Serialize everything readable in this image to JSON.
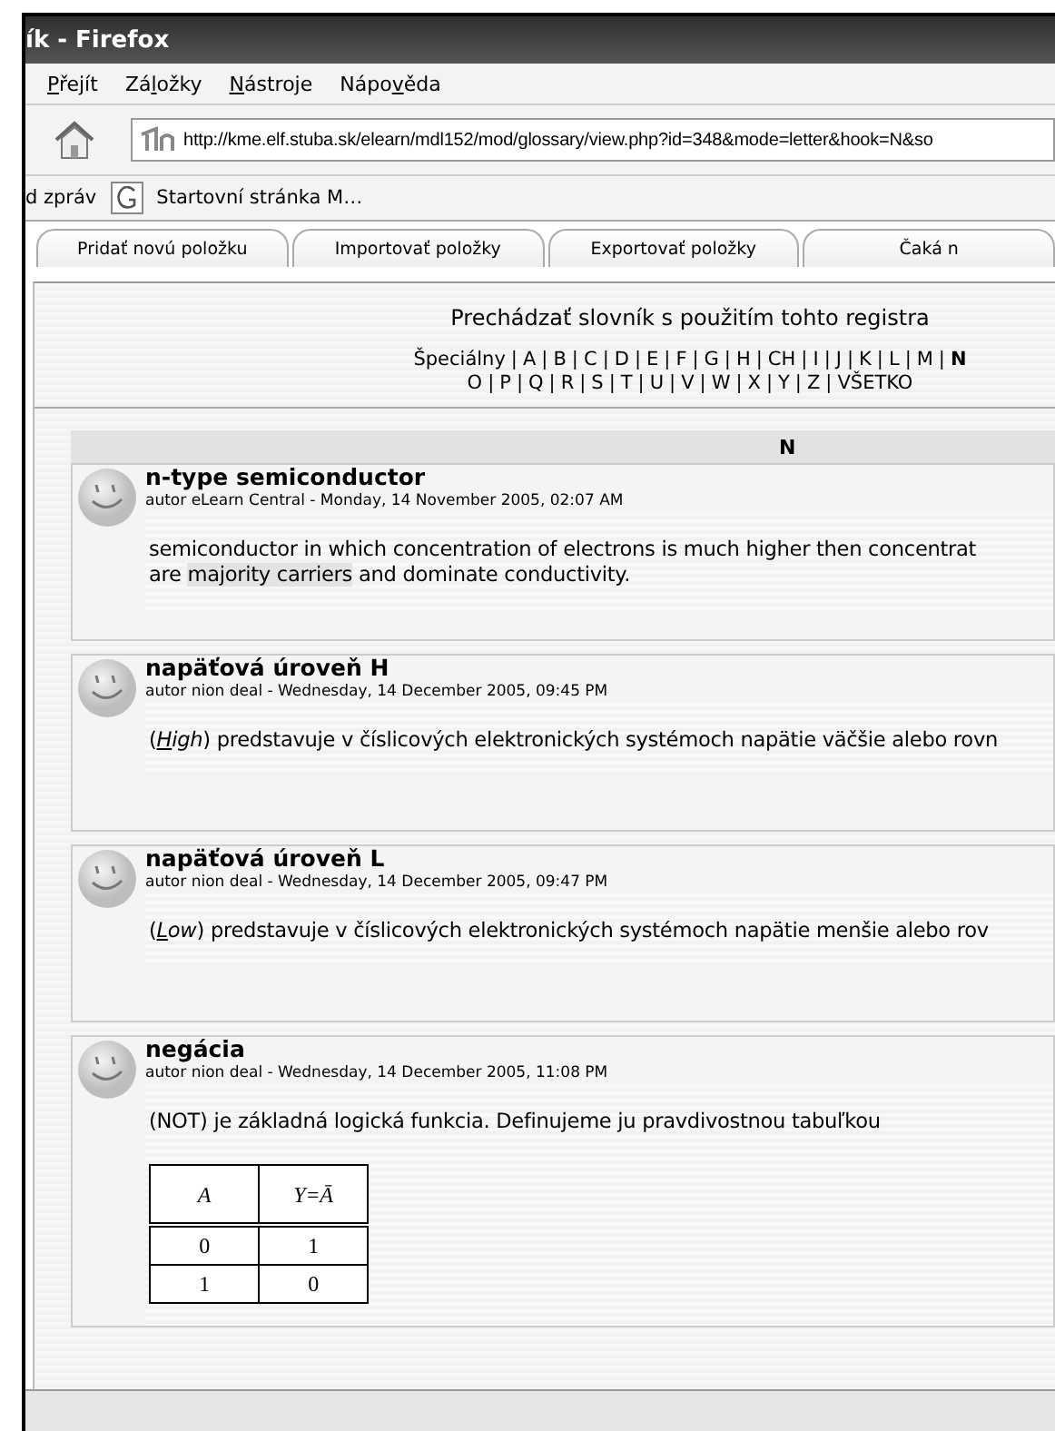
{
  "window": {
    "title": "ík - Firefox"
  },
  "menu": [
    {
      "key": "P",
      "after": "řejít"
    },
    {
      "before": "Zá",
      "key": "l",
      "after": "ožky"
    },
    {
      "key": "N",
      "after": "ástroje"
    },
    {
      "before": "Nápo",
      "key": "v",
      "after": "ěda"
    }
  ],
  "address_bar": {
    "value": "http://kme.elf.stuba.sk/elearn/mdl152/mod/glossary/view.php?id=348&mode=letter&hook=N&so"
  },
  "bookmarks": [
    {
      "label": "d zpráv",
      "kind": "plain"
    },
    {
      "label": "Startovní stránka M…",
      "kind": "google"
    }
  ],
  "tabs": [
    {
      "label": "Pridať novú položku",
      "selected": false
    },
    {
      "label": "Importovať položky",
      "selected": false
    },
    {
      "label": "Exportovať položky",
      "selected": false
    },
    {
      "label": "Čaká n",
      "selected": false
    }
  ],
  "browse": {
    "title": "Prechádzať slovník s použitím tohto registra",
    "separator": "|",
    "lines": [
      {
        "letters": [
          {
            "label": "Špeciálny",
            "selected": false
          },
          {
            "label": "A",
            "selected": false
          },
          {
            "label": "B",
            "selected": false
          },
          {
            "label": "C",
            "selected": false
          },
          {
            "label": "D",
            "selected": false
          },
          {
            "label": "E",
            "selected": false
          },
          {
            "label": "F",
            "selected": false
          },
          {
            "label": "G",
            "selected": false
          },
          {
            "label": "H",
            "selected": false
          },
          {
            "label": "CH",
            "selected": false
          },
          {
            "label": "I",
            "selected": false
          },
          {
            "label": "J",
            "selected": false
          },
          {
            "label": "K",
            "selected": false
          },
          {
            "label": "L",
            "selected": false
          },
          {
            "label": "M",
            "selected": false
          },
          {
            "label": "N",
            "selected": true
          }
        ]
      },
      {
        "letters": [
          {
            "label": "O",
            "selected": false
          },
          {
            "label": "P",
            "selected": false
          },
          {
            "label": "Q",
            "selected": false
          },
          {
            "label": "R",
            "selected": false
          },
          {
            "label": "S",
            "selected": false
          },
          {
            "label": "T",
            "selected": false
          },
          {
            "label": "U",
            "selected": false
          },
          {
            "label": "V",
            "selected": false
          },
          {
            "label": "W",
            "selected": false
          },
          {
            "label": "X",
            "selected": false
          },
          {
            "label": "Y",
            "selected": false
          },
          {
            "label": "Z",
            "selected": false
          },
          {
            "label": "VŠETKO",
            "selected": false
          }
        ]
      }
    ]
  },
  "section_heading": "N",
  "entries": [
    {
      "term": "n-type semiconductor",
      "meta": "autor eLearn Central - Monday, 14 November 2005, 02:07 AM",
      "body": [
        [
          {
            "kind": "plain",
            "text": "semiconductor in which concentration of electrons is much higher then concentrat"
          }
        ],
        [
          {
            "kind": "plain",
            "text": "are "
          },
          {
            "kind": "link",
            "text": "majority carriers"
          },
          {
            "kind": "plain",
            "text": " and dominate conductivity."
          }
        ]
      ]
    },
    {
      "term": "napäťová úroveň H",
      "meta": "autor nion deal - Wednesday, 14 December 2005, 09:45 PM",
      "body": [
        [
          {
            "kind": "plain",
            "text": "("
          },
          {
            "kind": "abbr",
            "text": "High"
          },
          {
            "kind": "plain",
            "text": ") predstavuje v číslicových elektronických systémoch napätie väčšie alebo rovn"
          }
        ]
      ]
    },
    {
      "term": "napäťová úroveň L",
      "meta": "autor nion deal - Wednesday, 14 December 2005, 09:47 PM",
      "body": [
        [
          {
            "kind": "plain",
            "text": "("
          },
          {
            "kind": "abbr",
            "text": "Low"
          },
          {
            "kind": "plain",
            "text": ") predstavuje v číslicových elektronických systémoch napätie menšie alebo rov"
          }
        ]
      ]
    },
    {
      "term": "negácia",
      "meta": "autor nion deal - Wednesday, 14 December 2005, 11:08 PM",
      "body": [
        [
          {
            "kind": "plain",
            "text": "(NOT) je základná logická funkcia. Definujeme ju pravdivostnou tabuľkou"
          }
        ]
      ],
      "truth_table": {
        "columns": [
          "A",
          "Y=Ā"
        ],
        "rows": [
          [
            "0",
            "1"
          ],
          [
            "1",
            "0"
          ]
        ]
      }
    }
  ]
}
